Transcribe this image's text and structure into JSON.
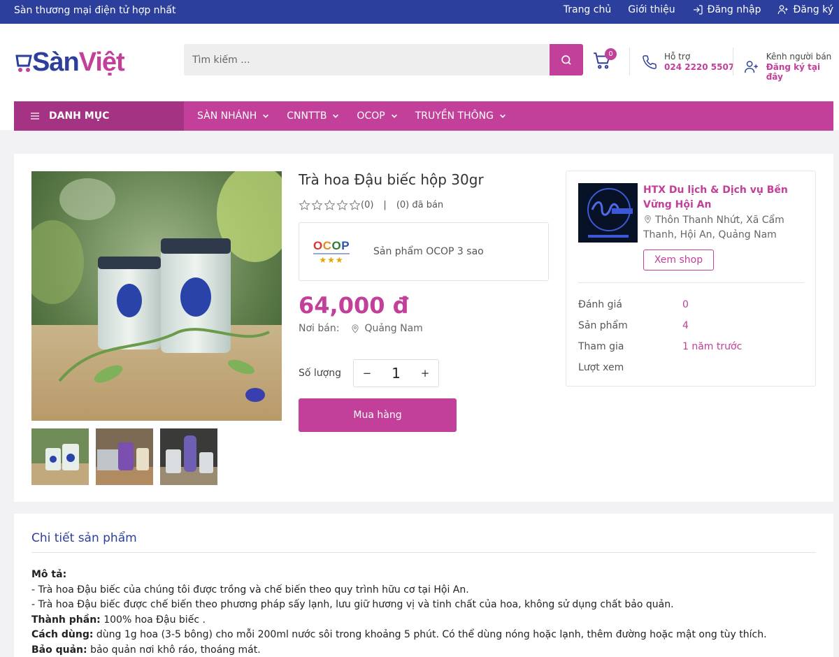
{
  "topbar": {
    "slogan": "Sàn thương mại điện tử hợp nhất",
    "links": {
      "home": "Trang chủ",
      "about": "Giới thiệu",
      "login": "Đăng nhập",
      "register": "Đăng ký"
    }
  },
  "header": {
    "logo": {
      "part1": "Sàn",
      "part2": "Việt"
    },
    "search_placeholder": "Tìm kiếm ...",
    "cart_count": "0",
    "hotline": {
      "label": "Hỗ trợ",
      "phone": "024 2220 5507"
    },
    "seller": {
      "label": "Kênh người bán",
      "action": "Đăng ký tại đây"
    }
  },
  "nav": {
    "category": "DANH MỤC",
    "items": [
      "SÀN NHÁNH",
      "CNNTTB",
      "OCOP",
      "TRUYỀN THÔNG"
    ]
  },
  "product": {
    "title": "Trà hoa Đậu biếc hộp 30gr",
    "rating_count": "(0)",
    "sold": "(0) đã bán",
    "ocop_logo": "OCOP",
    "ocop_stars": "★★★",
    "ocop_label": "Sản phẩm OCOP 3 sao",
    "price": "64,000 đ",
    "origin_label": "Nơi bán:",
    "origin": "Quảng Nam",
    "qty_label": "Số lượng",
    "qty": "1",
    "buy": "Mua hàng"
  },
  "shop": {
    "name": "HTX Du lịch & Dịch vụ Bền Vững Hội An",
    "address": "Thôn Thanh Nhứt, Xã Cẩm Thanh, Hội An, Quảng Nam",
    "view_button": "Xem shop",
    "stats": [
      {
        "label": "Đánh giá",
        "value": "0"
      },
      {
        "label": "Sản phẩm",
        "value": "4"
      },
      {
        "label": "Tham gia",
        "value": "1 năm trước"
      },
      {
        "label": "Lượt xem",
        "value": ""
      }
    ]
  },
  "details": {
    "title": "Chi tiết sản phẩm",
    "desc_label": "Mô tả:",
    "desc_lines": [
      "- Trà hoa Đậu biếc của chúng tôi được trồng và chế biến theo quy trình hữu cơ tại Hội An.",
      "- Trà hoa Đậu biếc được chế biến theo phương pháp sấy lạnh, lưu giữ hương vị và tinh chất của hoa, không sử dụng chất bảo quản."
    ],
    "ingredients_label": "Thành phần:",
    "ingredients": " 100% hoa Đậu biếc .",
    "usage_label": "Cách dùng:",
    "usage": " dùng 1g hoa (3-5 bông) cho mỗi 200ml nước sôi trong khoảng 5 phút. Có thể dùng nóng hoặc lạnh, thêm đường hoặc mật ong tùy thích.",
    "storage_label": "Bảo quản:",
    "storage": " bảo quản nơi khô ráo, thoáng mát."
  },
  "colors": {
    "brand_blue": "#2c3f9c",
    "brand_pink": "#c2409a"
  },
  "icons": [
    "login-icon",
    "user-plus-icon",
    "search-icon",
    "cart-icon",
    "phone-icon",
    "seller-icon",
    "menu-icon",
    "chevron-down-icon",
    "star-outline-icon",
    "map-pin-icon"
  ]
}
